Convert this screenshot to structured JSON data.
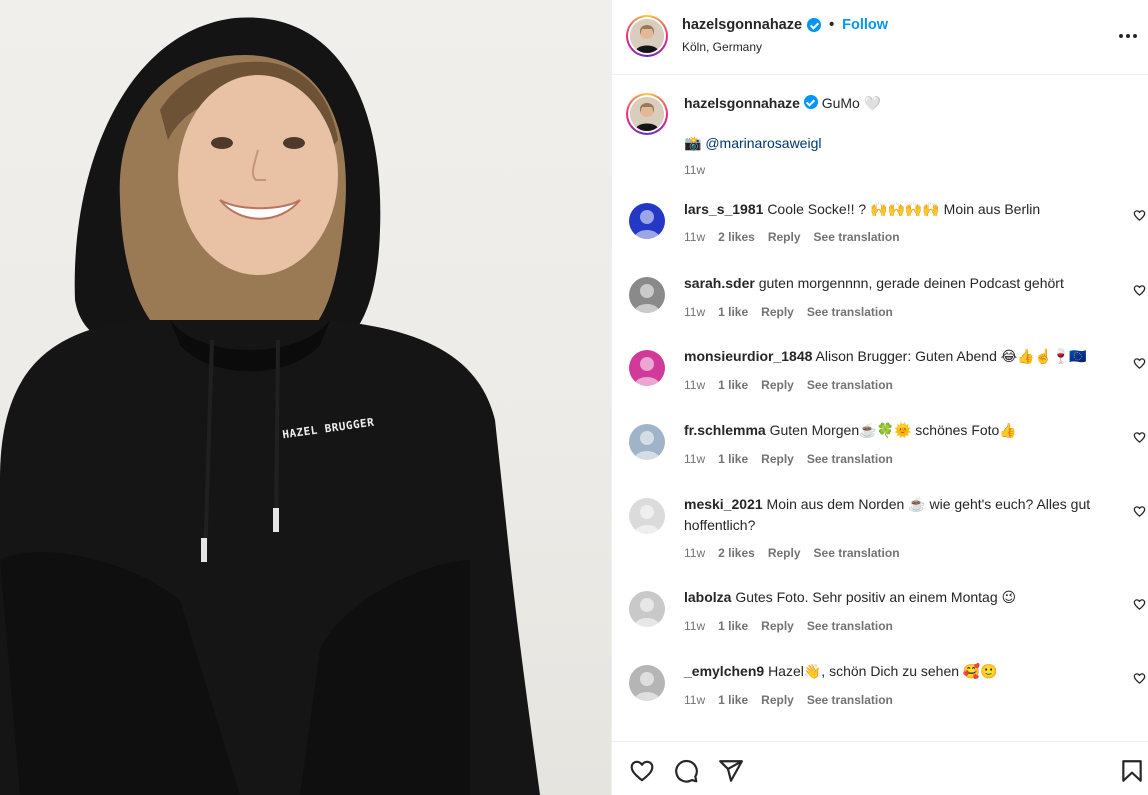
{
  "post": {
    "username": "hazelsgonnahaze",
    "separator": "•",
    "follow_label": "Follow",
    "location": "Köln, Germany",
    "caption_text": "GuMo 🤍",
    "caption_line2_prefix": "📸",
    "caption_mention": "@marinarosaweigl",
    "caption_time": "11w"
  },
  "photo": {
    "hoodie_text": "HAZEL BRUGGER"
  },
  "comments": [
    {
      "username": "lars_s_1981",
      "text": "Coole Socke!! ? 🙌🙌🙌🙌 Moin aus Berlin",
      "time": "11w",
      "likes": "2 likes",
      "reply": "Reply",
      "translate": "See translation",
      "avatar_color": "#2438c7"
    },
    {
      "username": "sarah.sder",
      "text": "guten morgennnn, gerade deinen Podcast gehört",
      "time": "11w",
      "likes": "1 like",
      "reply": "Reply",
      "translate": "See translation",
      "avatar_color": "#8a8a8a"
    },
    {
      "username": "monsieurdior_1848",
      "text": "Alison Brugger: Guten Abend 😂👍☝️🍷🇪🇺",
      "time": "11w",
      "likes": "1 like",
      "reply": "Reply",
      "translate": "See translation",
      "avatar_color": "#d23a9a"
    },
    {
      "username": "fr.schlemma",
      "text": "Guten Morgen☕️🍀🌞 schönes Foto👍",
      "time": "11w",
      "likes": "1 like",
      "reply": "Reply",
      "translate": "See translation",
      "avatar_color": "#9fb4c8"
    },
    {
      "username": "meski_2021",
      "text": "Moin aus dem Norden ☕️ wie geht's euch? Alles gut hoffentlich?",
      "time": "11w",
      "likes": "2 likes",
      "reply": "Reply",
      "translate": "See translation",
      "avatar_color": "#dbdbdb"
    },
    {
      "username": "labolza",
      "text": "Gutes Foto. Sehr positiv an einem Montag 😉",
      "time": "11w",
      "likes": "1 like",
      "reply": "Reply",
      "translate": "See translation",
      "avatar_color": "#c9c9c9"
    },
    {
      "username": "_emylchen9",
      "text": "Hazel👋, schön Dich zu sehen 🥰🙂",
      "time": "11w",
      "likes": "1 like",
      "reply": "Reply",
      "translate": "See translation",
      "avatar_color": "#b5b5b5"
    }
  ],
  "colors": {
    "accent": "#0095f6",
    "text": "#262626",
    "muted": "#737373",
    "mention": "#00376b"
  },
  "icons": {
    "like": "heart-icon",
    "comment": "comment-icon",
    "share": "share-icon",
    "save": "bookmark-icon",
    "more": "more-options-icon",
    "verified": "verified-badge-icon"
  }
}
